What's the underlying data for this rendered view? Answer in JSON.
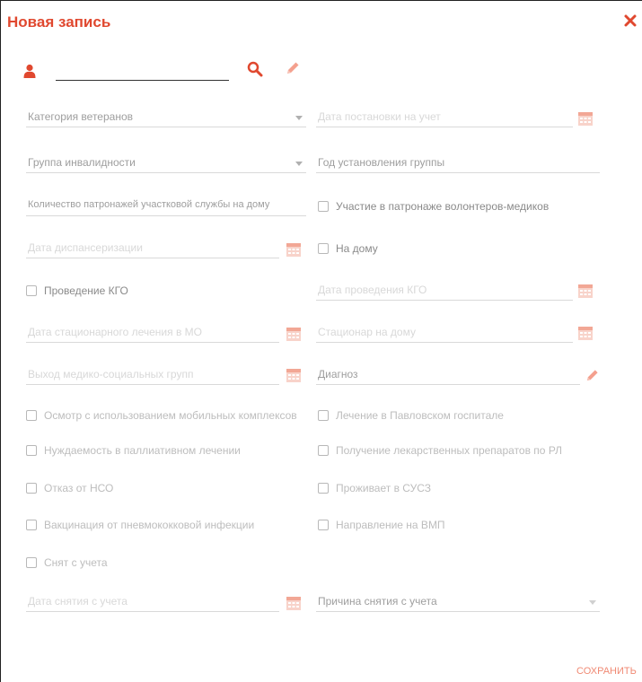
{
  "dialog": {
    "title": "Новая запись",
    "save_label": "СОХРАНИТЬ",
    "accent_color": "#e0482f"
  },
  "user_row": {
    "value": ""
  },
  "fields": {
    "veteran_category": "Категория ветеранов",
    "registration_date": "Дата постановки на учет",
    "disability_group": "Группа инвалидности",
    "group_year": "Год установления группы",
    "patronage_count": "Количество патронажей участковой службы на дому",
    "dispensary_date": "Дата диспансеризации",
    "kgo_date": "Дата проведения КГО",
    "inpatient_date": "Дата стационарного лечения в МО",
    "home_hospital": "Стационар на дому",
    "msg_exit": "Выход медико-социальных групп",
    "diagnosis": "Диагноз",
    "deregistration_date": "Дата снятия с учета",
    "deregistration_reason": "Причина снятия с учета"
  },
  "checkboxes": {
    "volunteer_patronage": "Участие в патронаже волонтеров-медиков",
    "at_home": "На дому",
    "kgo": "Проведение КГО",
    "mobile_exam": "Осмотр с использованием мобильных комплексов",
    "pavlovsky": "Лечение в Павловском госпитале",
    "palliative": "Нуждаемость в паллиативном лечении",
    "drugs_rl": "Получение лекарственных препаратов по РЛ",
    "nso_refusal": "Отказ от НСО",
    "lives_susz": "Проживает в СУСЗ",
    "pneumo_vaccine": "Вакцинация от пневмококковой инфекции",
    "vmp_referral": "Направление на ВМП",
    "deregistered": "Снят с учета"
  },
  "icons": {
    "user": "user-icon",
    "search": "search-icon",
    "edit": "pencil-icon",
    "calendar": "calendar-icon",
    "close": "close-icon"
  }
}
